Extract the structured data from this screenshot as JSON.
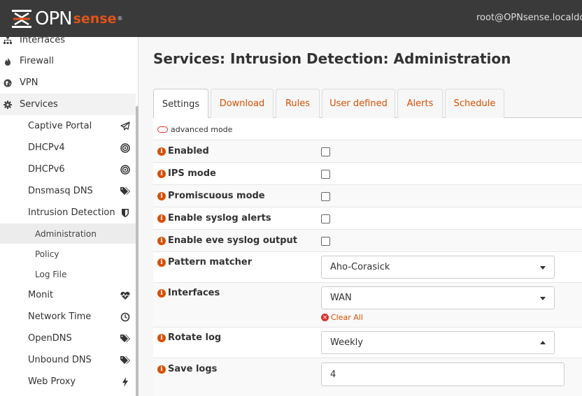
{
  "header": {
    "logo_main": "OPN",
    "logo_sense": "sense",
    "logo_reg": "®",
    "user": "root@OPNsense.localdom"
  },
  "sidebar": {
    "top_items": [
      {
        "label": "Interfaces",
        "icon": "sitemap-icon"
      },
      {
        "label": "Firewall",
        "icon": "fire-icon"
      },
      {
        "label": "VPN",
        "icon": "globe-icon"
      },
      {
        "label": "Services",
        "icon": "cog-icon"
      }
    ],
    "services_items": [
      {
        "label": "Captive Portal",
        "icon": "paper-plane-icon"
      },
      {
        "label": "DHCPv4",
        "icon": "bullseye-icon"
      },
      {
        "label": "DHCPv6",
        "icon": "bullseye-icon"
      },
      {
        "label": "Dnsmasq DNS",
        "icon": "tags-icon"
      },
      {
        "label": "Intrusion Detection",
        "icon": "shield-icon"
      },
      {
        "label": "Monit",
        "icon": "heartbeat-icon"
      },
      {
        "label": "Network Time",
        "icon": "clock-icon"
      },
      {
        "label": "OpenDNS",
        "icon": "tags-icon"
      },
      {
        "label": "Unbound DNS",
        "icon": "tags-icon"
      },
      {
        "label": "Web Proxy",
        "icon": "bolt-icon"
      }
    ],
    "ids_items": [
      {
        "label": "Administration"
      },
      {
        "label": "Policy"
      },
      {
        "label": "Log File"
      }
    ]
  },
  "main": {
    "title": "Services: Intrusion Detection: Administration",
    "tabs": [
      {
        "label": "Settings"
      },
      {
        "label": "Download"
      },
      {
        "label": "Rules"
      },
      {
        "label": "User defined"
      },
      {
        "label": "Alerts"
      },
      {
        "label": "Schedule"
      }
    ],
    "advanced_mode": "advanced mode",
    "fields": {
      "enabled": "Enabled",
      "ips_mode": "IPS mode",
      "promiscuous": "Promiscuous mode",
      "syslog_alerts": "Enable syslog alerts",
      "eve_syslog": "Enable eve syslog output",
      "pattern_matcher": {
        "label": "Pattern matcher",
        "value": "Aho-Corasick"
      },
      "interfaces": {
        "label": "Interfaces",
        "value": "WAN",
        "clear": "Clear All"
      },
      "rotate_log": {
        "label": "Rotate log",
        "value": "Weekly"
      },
      "save_logs": {
        "label": "Save logs",
        "value": "4"
      }
    },
    "info_glyph": "i",
    "clear_glyph": "×"
  },
  "colors": {
    "accent": "#d94f00",
    "topbar": "#3a3a3a",
    "danger": "#d9322b"
  }
}
